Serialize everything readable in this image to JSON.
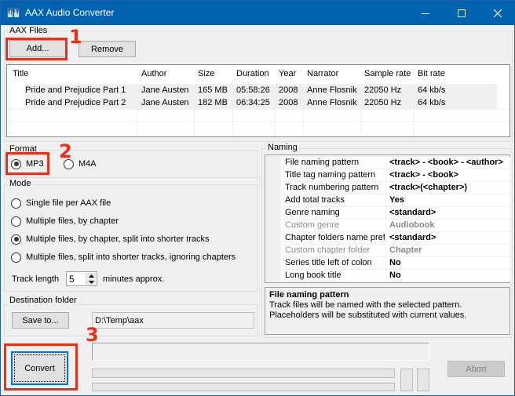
{
  "window": {
    "title": "AAX Audio Converter",
    "icon": "waveform-app-icon",
    "controls": {
      "minimize": "minimize-icon",
      "maximize": "maximize-icon",
      "close": "close-icon"
    }
  },
  "aax_files": {
    "group_label": "AAX Files",
    "add_label": "Add...",
    "remove_label": "Remove",
    "columns": [
      "Title",
      "Author",
      "Size",
      "Duration",
      "Year",
      "Narrator",
      "Sample rate",
      "Bit rate"
    ],
    "rows": [
      [
        "Pride and Prejudice Part 1",
        "Jane Austen",
        "165 MB",
        "05:58:26",
        "2008",
        "Anne Flosnik",
        "22050 Hz",
        "64 kb/s"
      ],
      [
        "Pride and Prejudice Part 2",
        "Jane Austen",
        "182 MB",
        "06:34:25",
        "2008",
        "Anne Flosnik",
        "22050 Hz",
        "64 kb/s"
      ]
    ]
  },
  "format": {
    "group_label": "Format",
    "options": [
      {
        "label": "MP3",
        "selected": true
      },
      {
        "label": "M4A",
        "selected": false
      }
    ]
  },
  "mode": {
    "group_label": "Mode",
    "options": [
      {
        "label": "Single file per AAX file",
        "selected": false
      },
      {
        "label": "Multiple files, by chapter",
        "selected": false
      },
      {
        "label": "Multiple files, by chapter, split into shorter tracks",
        "selected": true
      },
      {
        "label": "Multiple files, split into shorter tracks, ignoring chapters",
        "selected": false
      }
    ],
    "track_length_label": "Track length",
    "track_length_value": "5",
    "track_length_suffix": "minutes approx."
  },
  "destination": {
    "group_label": "Destination folder",
    "save_to_label": "Save to...",
    "path": "D:\\Temp\\aax"
  },
  "naming": {
    "group_label": "Naming",
    "properties": [
      {
        "name": "File naming pattern",
        "value": "<track> - <book> - <author>",
        "enabled": true
      },
      {
        "name": "Title tag naming pattern",
        "value": "<track> - <book>",
        "enabled": true
      },
      {
        "name": "Track numbering pattern",
        "value": "<track>(<chapter>)",
        "enabled": true
      },
      {
        "name": "Add total tracks",
        "value": "Yes",
        "enabled": true
      },
      {
        "name": "Genre naming",
        "value": "<standard>",
        "enabled": true
      },
      {
        "name": "Custom genre",
        "value": "Audiobook",
        "enabled": false
      },
      {
        "name": "Chapter folders name prefi",
        "value": "<standard>",
        "enabled": true
      },
      {
        "name": "Custom chapter folder",
        "value": "Chapter",
        "enabled": false
      },
      {
        "name": "Series title left of colon",
        "value": "No",
        "enabled": true
      },
      {
        "name": "Long book title",
        "value": "No",
        "enabled": true
      }
    ],
    "help_title": "File naming pattern",
    "help_lines": [
      "Track files will be named with the selected pattern.",
      "Placeholders will be substituted with current values."
    ]
  },
  "actions": {
    "convert_label": "Convert",
    "abort_label": "Abort",
    "status_text": ""
  },
  "annotations": {
    "step1": "1",
    "step2": "2",
    "step3": "3",
    "color": "#e8311a"
  }
}
